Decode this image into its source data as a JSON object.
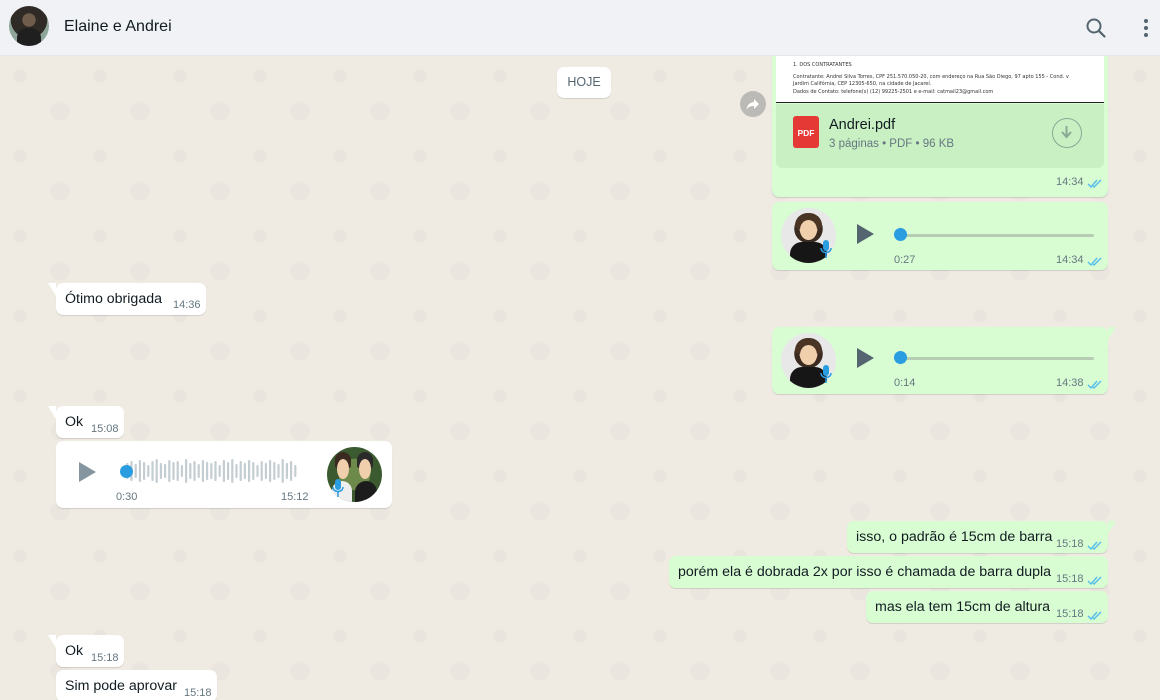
{
  "header": {
    "contact_name": "Elaine e Andrei"
  },
  "chat": {
    "date_chip": "HOJE",
    "document": {
      "preview_lines": [
        "1. DOS CONTRATANTES",
        "Contratante: Andrei Silva Torres, CPF 251.570.050-20, com endereço na Rua São Diego, 97 apto 155 - Cond. v",
        "Jardim Califórnia, CEP 12305-650, na cidade de Jacareí.",
        "Dados de Contato: telefone(s) (12) 99225-2501 e e-mail: catmail23@gmail.com"
      ],
      "file_name": "Andrei.pdf",
      "file_meta": "3 páginas • PDF • 96 KB",
      "pdf_label": "PDF",
      "time": "14:34"
    },
    "voice_out_1": {
      "duration": "0:27",
      "time": "14:34",
      "progress": 0
    },
    "msg_otimo": {
      "text": "Ótimo obrigada",
      "time": "14:36"
    },
    "voice_out_2": {
      "duration": "0:14",
      "time": "14:38",
      "progress": 0
    },
    "msg_ok_1": {
      "text": "Ok",
      "time": "15:08"
    },
    "voice_in": {
      "duration": "0:30",
      "time": "15:12",
      "progress": 0
    },
    "msg_padrao": {
      "text": "isso, o padrão é 15cm de barra",
      "time": "15:18"
    },
    "msg_dobrada": {
      "text": "porém ela é dobrada 2x por isso é chamada de barra dupla",
      "time": "15:18"
    },
    "msg_altura": {
      "text": "mas ela tem 15cm de altura",
      "time": "15:18"
    },
    "msg_ok_2": {
      "text": "Ok",
      "time": "15:18"
    },
    "msg_aprovar": {
      "text": "Sim pode aprovar",
      "time": "15:18"
    }
  },
  "colors": {
    "outgoing_bubble": "#d9fdd3",
    "incoming_bubble": "#ffffff",
    "read_ticks": "#53bdeb",
    "chat_background": "#efeae2",
    "header_background": "#f0f2f5"
  },
  "icons": [
    "search-icon",
    "menu-icon",
    "forward-icon",
    "download-icon",
    "play-icon",
    "mic-icon",
    "double-check-icon",
    "pdf-icon"
  ]
}
